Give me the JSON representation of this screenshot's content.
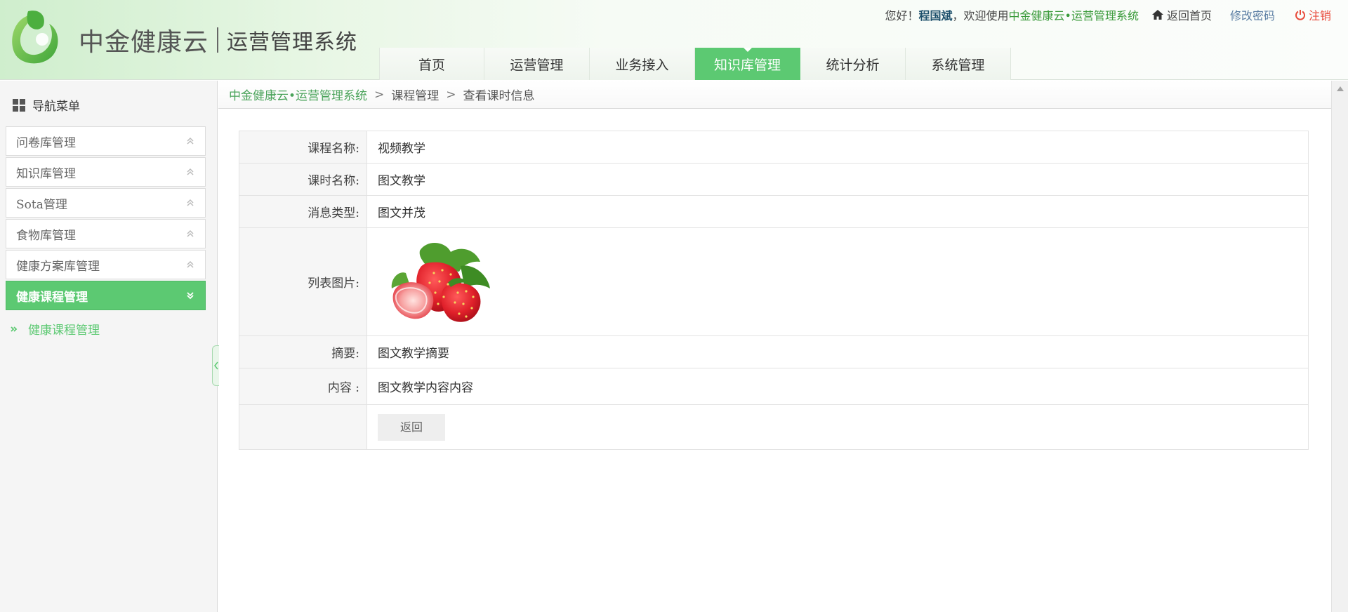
{
  "header": {
    "brand_name": "中金健康云",
    "system_name": "运营管理系统",
    "greeting": "您好！",
    "user_name": "程国斌",
    "welcome_prefix": "，欢迎使用",
    "welcome_system": "中金健康云•运营管理系统",
    "home_link": "返回首页",
    "change_password": "修改密码",
    "logout": "注销",
    "nav": [
      {
        "label": "首页",
        "active": false
      },
      {
        "label": "运营管理",
        "active": false
      },
      {
        "label": "业务接入",
        "active": false
      },
      {
        "label": "知识库管理",
        "active": true
      },
      {
        "label": "统计分析",
        "active": false
      },
      {
        "label": "系统管理",
        "active": false
      }
    ]
  },
  "sidebar": {
    "title": "导航菜单",
    "items": [
      {
        "label": "问卷库管理"
      },
      {
        "label": "知识库管理"
      },
      {
        "label": "Sota管理"
      },
      {
        "label": "食物库管理"
      },
      {
        "label": "健康方案库管理"
      },
      {
        "label": "健康课程管理",
        "active": true
      }
    ],
    "submenu": "健康课程管理"
  },
  "breadcrumb": [
    "中金健康云•运营管理系统",
    "课程管理",
    "查看课时信息"
  ],
  "detail": {
    "course_name_label": "课程名称:",
    "course_name": "视频教学",
    "lesson_name_label": "课时名称:",
    "lesson_name": "图文教学",
    "message_type_label": "消息类型:",
    "message_type": "图文并茂",
    "list_image_label": "列表图片:",
    "summary_label": "摘要:",
    "summary": "图文教学摘要",
    "content_label": "内容 :",
    "content": "图文教学内容内容",
    "back_button": "返回"
  },
  "colors": {
    "accent": "#5cc972",
    "logout": "#e84a3a",
    "link": "#5b7ea3"
  },
  "icons": [
    "leaf-logo-icon",
    "home-icon",
    "power-icon",
    "grid-icon",
    "chevron-up-double-icon",
    "chevron-down-double-icon",
    "chevron-right-double-icon",
    "collapse-arrow-icon"
  ]
}
